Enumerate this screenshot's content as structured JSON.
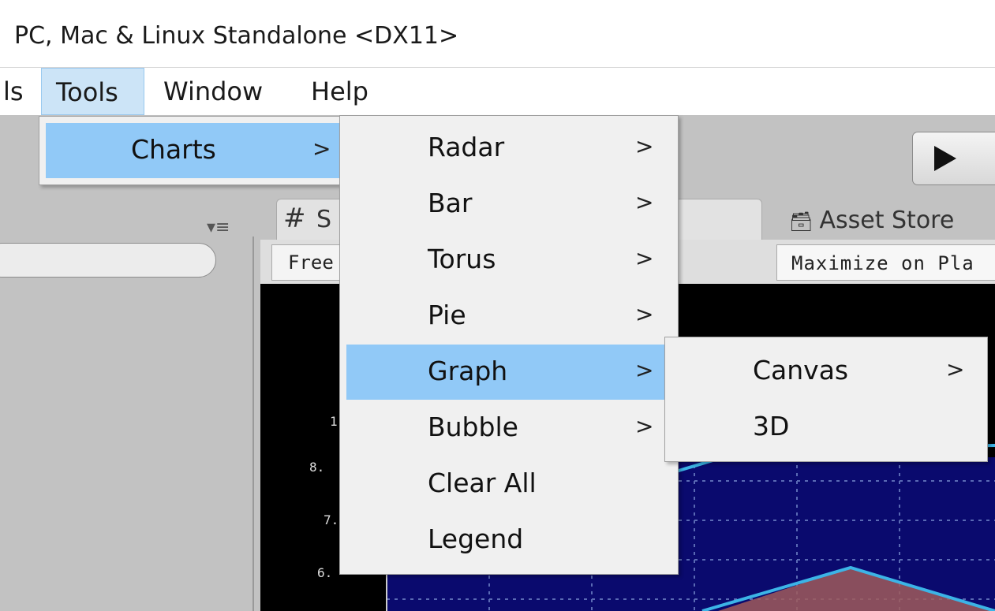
{
  "title_bar": {
    "title": "PC, Mac & Linux Standalone <DX11>"
  },
  "menubar": {
    "items": [
      {
        "label": "ls"
      },
      {
        "label": "Tools"
      },
      {
        "label": "Window"
      },
      {
        "label": "Help"
      }
    ]
  },
  "toolbar": {
    "play_icon": "play-icon"
  },
  "panels": {
    "scene_tab_label": "S",
    "asset_store_tab_label": "Asset Store",
    "free_aspect_label": "Free",
    "maximize_label": "Maximize on Pla"
  },
  "game_view": {
    "tick_labels": [
      "1",
      "8.",
      "7.",
      "6."
    ],
    "colors": {
      "plot_bg": "#0a0a6e",
      "grid": "#5a6ab4",
      "line": "#3cb4e6",
      "area": "#a05a5a"
    }
  },
  "tools_menu": {
    "charts_label": "Charts",
    "arrow": ">"
  },
  "charts_submenu": {
    "items": [
      {
        "label": "Radar",
        "arrow": ">"
      },
      {
        "label": "Bar",
        "arrow": ">"
      },
      {
        "label": "Torus",
        "arrow": ">"
      },
      {
        "label": "Pie",
        "arrow": ">"
      },
      {
        "label": "Graph",
        "arrow": ">"
      },
      {
        "label": "Bubble",
        "arrow": ">"
      },
      {
        "label": "Clear All",
        "arrow": ""
      },
      {
        "label": "Legend",
        "arrow": ""
      }
    ]
  },
  "graph_submenu": {
    "items": [
      {
        "label": "Canvas",
        "arrow": ">"
      },
      {
        "label": "3D",
        "arrow": ""
      }
    ]
  }
}
